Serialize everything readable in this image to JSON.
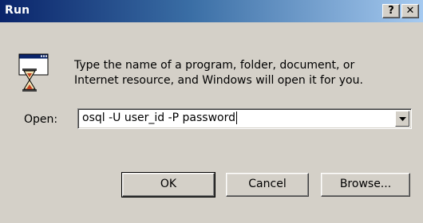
{
  "window": {
    "title": "Run",
    "help_glyph": "?",
    "close_glyph": "✕"
  },
  "icons": {
    "app": "run-dialog-icon",
    "dropdown": "chevron-down-icon"
  },
  "description": {
    "line1": "Type the name of a program, folder, document, or",
    "line2": "Internet resource, and Windows will open it for you."
  },
  "open": {
    "label": "Open:",
    "value": "osql -U user_id -P password"
  },
  "buttons": {
    "ok": "OK",
    "cancel": "Cancel",
    "browse": "Browse..."
  },
  "colors": {
    "titlebar_start": "#0a246a",
    "titlebar_end": "#a6caf0",
    "face": "#d4d0c8"
  }
}
